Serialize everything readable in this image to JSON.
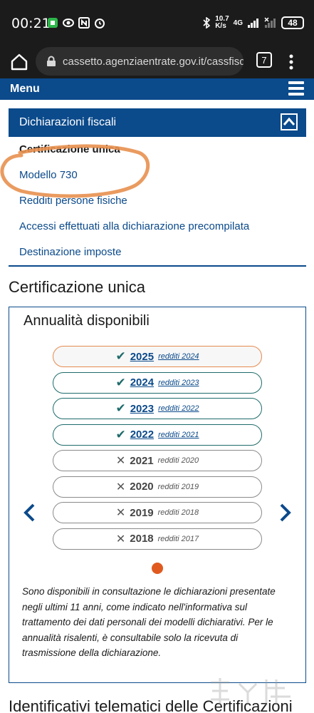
{
  "status_bar": {
    "time": "00:21",
    "net_speed_value": "10.7",
    "net_speed_unit": "K/s",
    "network_type": "4G",
    "battery": "48"
  },
  "browser": {
    "url": "cassetto.agenziaentrate.gov.it/cassfisc-w",
    "tab_count": "7"
  },
  "site_menu": {
    "label": "Menu"
  },
  "submenu": {
    "title": "Dichiarazioni fiscali",
    "items": [
      {
        "label": "Certificazione unica"
      },
      {
        "label": "Modello 730"
      },
      {
        "label": "Redditi persone fisiche"
      },
      {
        "label": "Accessi effettuati alla dichiarazione precompilata"
      },
      {
        "label": "Destinazione imposte"
      }
    ]
  },
  "main": {
    "section_title": "Certificazione unica",
    "panel_title": "Annualità disponibili",
    "years": [
      {
        "year": "2025",
        "sub": "redditi 2024",
        "available": true
      },
      {
        "year": "2024",
        "sub": "redditi 2023",
        "available": true
      },
      {
        "year": "2023",
        "sub": "redditi 2022",
        "available": true
      },
      {
        "year": "2022",
        "sub": "redditi 2021",
        "available": true
      },
      {
        "year": "2021",
        "sub": "redditi 2020",
        "available": false
      },
      {
        "year": "2020",
        "sub": "redditi 2019",
        "available": false
      },
      {
        "year": "2019",
        "sub": "redditi 2018",
        "available": false
      },
      {
        "year": "2018",
        "sub": "redditi 2017",
        "available": false
      }
    ],
    "info_text": "Sono disponibili in consultazione le dichiarazioni presentate negli ultimi 11 anni, come indicato nell'informativa sul trattamento dei dati personali dei modelli dichiarativi. Per le annualità risalenti, è consultabile solo la ricevuta di trasmissione della dichiarazione.",
    "next_section_title": "Identificativi telematici delle Certificazioni"
  },
  "colors": {
    "brand_blue": "#0b4a8b",
    "available_green": "#1e6b6b",
    "carousel_dot": "#e05a1f",
    "annotation_orange": "#e8904f"
  },
  "icons": [
    "home-icon",
    "lock-icon",
    "more-vert-icon",
    "hamburger-icon",
    "chevron-up-icon",
    "check-icon",
    "x-icon",
    "chevron-left-icon",
    "chevron-right-icon"
  ]
}
